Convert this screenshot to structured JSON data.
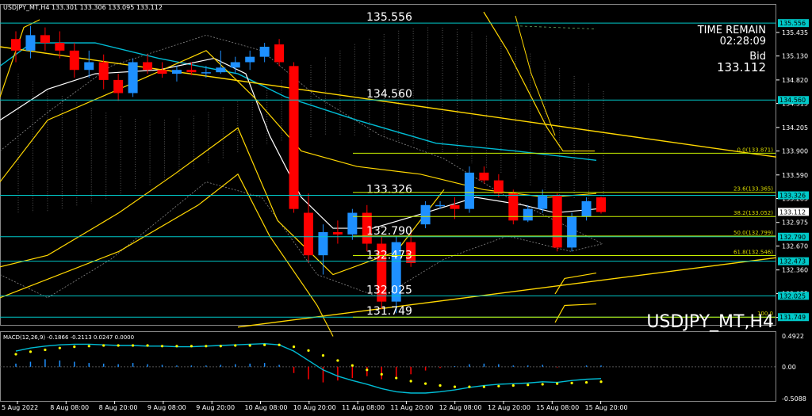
{
  "window": {
    "header": "USDJPY_MT,H4  133.301 133.306 133.095 133.112",
    "watermark": "USDJPY_MT,H4"
  },
  "time_remain": {
    "title": "TIME REMAIN",
    "value": "02:28:09",
    "bid_label": "Bid",
    "bid_value": "133.112"
  },
  "colors": {
    "background": "#000000",
    "bull": "#1e90ff",
    "bear": "#ff0000",
    "hline": "#00c8c8",
    "fib": "#c8f000",
    "trend": "#ffd700",
    "ma_white": "#ffffff",
    "ma_cyan": "#00bcd4",
    "macd_hist": "#1e90ff",
    "macd_line": "#00bcd4",
    "macd_signal": "#ffff00"
  },
  "levels": [
    {
      "label": "135.556",
      "price": 135.556
    },
    {
      "label": "134.560",
      "price": 134.56
    },
    {
      "label": "133.326",
      "price": 133.326
    },
    {
      "label": "132.790",
      "price": 132.79
    },
    {
      "label": "132.473",
      "price": 132.473
    },
    {
      "label": "132.025",
      "price": 132.025
    },
    {
      "label": "131.749",
      "price": 131.749
    }
  ],
  "fib": [
    {
      "label": "0.0(133.871)",
      "price": 133.871
    },
    {
      "label": "23.6(133.365)",
      "price": 133.365
    },
    {
      "label": "38.2(133.052)",
      "price": 133.052
    },
    {
      "label": "50.0(132.799)",
      "price": 132.799
    },
    {
      "label": "61.8(132.546)",
      "price": 132.546
    },
    {
      "label": "100.0",
      "price": 131.749
    }
  ],
  "price_axis": {
    "ticks": [
      "135.435",
      "135.130",
      "134.820",
      "134.515",
      "134.205",
      "133.900",
      "133.590",
      "133.285",
      "132.975",
      "132.670",
      "132.360",
      "132.055",
      "131.745"
    ],
    "tags": [
      {
        "label": "135.556",
        "price": 135.556,
        "color": "#00c8c8"
      },
      {
        "label": "134.560",
        "price": 134.56,
        "color": "#00c8c8"
      },
      {
        "label": "133.326",
        "price": 133.326,
        "color": "#00c8c8"
      },
      {
        "label": "133.112",
        "price": 133.112,
        "color": "#ffffff"
      },
      {
        "label": "132.790",
        "price": 132.79,
        "color": "#00c8c8"
      },
      {
        "label": "132.473",
        "price": 132.473,
        "color": "#00c8c8"
      },
      {
        "label": "132.025",
        "price": 132.025,
        "color": "#00c8c8"
      },
      {
        "label": "131.749",
        "price": 131.749,
        "color": "#00c8c8"
      }
    ]
  },
  "time_axis": [
    "5 Aug 2022",
    "8 Aug 08:00",
    "8 Aug 20:00",
    "9 Aug 08:00",
    "9 Aug 20:00",
    "10 Aug 08:00",
    "10 Aug 20:00",
    "11 Aug 08:00",
    "11 Aug 20:00",
    "12 Aug 08:00",
    "12 Aug 20:00",
    "15 Aug 08:00",
    "15 Aug 20:00"
  ],
  "macd": {
    "label": "MACD(12,26,9) -0.1866 -0.2113 0.0247 0.0000",
    "axis": [
      "0.4922",
      "0.00",
      "-0.5088"
    ],
    "range": [
      -0.5088,
      0.4922
    ]
  },
  "chart_data": {
    "type": "candlestick",
    "symbol": "USDJPY_MT",
    "timeframe": "H4",
    "ylim": [
      131.7,
      135.65
    ],
    "ohlc": [
      [
        135.35,
        135.45,
        135.05,
        135.2
      ],
      [
        135.2,
        135.52,
        135.1,
        135.4
      ],
      [
        135.4,
        135.5,
        135.2,
        135.3
      ],
      [
        135.3,
        135.45,
        135.1,
        135.2
      ],
      [
        135.2,
        135.3,
        134.85,
        134.95
      ],
      [
        134.95,
        135.2,
        134.85,
        135.05
      ],
      [
        135.05,
        135.15,
        134.7,
        134.82
      ],
      [
        134.82,
        134.9,
        134.55,
        134.65
      ],
      [
        134.65,
        135.1,
        134.6,
        135.05
      ],
      [
        135.05,
        135.15,
        134.9,
        134.95
      ],
      [
        134.95,
        135.05,
        134.85,
        134.9
      ],
      [
        134.9,
        135.0,
        134.8,
        134.95
      ],
      [
        134.95,
        135.05,
        134.88,
        134.92
      ],
      [
        134.92,
        135.0,
        134.85,
        134.92
      ],
      [
        134.92,
        135.2,
        134.9,
        134.98
      ],
      [
        134.98,
        135.12,
        134.9,
        135.05
      ],
      [
        135.05,
        135.2,
        134.95,
        135.12
      ],
      [
        135.12,
        135.3,
        135.05,
        135.25
      ],
      [
        135.28,
        135.35,
        135.0,
        135.05
      ],
      [
        135.0,
        135.05,
        133.1,
        133.15
      ],
      [
        133.1,
        133.35,
        132.45,
        132.55
      ],
      [
        132.55,
        132.95,
        132.3,
        132.85
      ],
      [
        132.85,
        133.0,
        132.7,
        132.82
      ],
      [
        132.82,
        133.15,
        132.75,
        133.1
      ],
      [
        133.1,
        133.2,
        132.6,
        132.7
      ],
      [
        132.7,
        132.8,
        131.85,
        131.95
      ],
      [
        131.95,
        132.8,
        131.8,
        132.72
      ],
      [
        132.72,
        132.9,
        132.4,
        132.45
      ],
      [
        132.95,
        133.25,
        132.9,
        133.2
      ],
      [
        133.2,
        133.25,
        133.15,
        133.2
      ],
      [
        133.2,
        133.3,
        133.02,
        133.15
      ],
      [
        133.15,
        133.7,
        133.1,
        133.62
      ],
      [
        133.62,
        133.7,
        133.48,
        133.52
      ],
      [
        133.52,
        133.6,
        133.3,
        133.35
      ],
      [
        133.35,
        133.4,
        132.95,
        133.0
      ],
      [
        133.0,
        133.2,
        132.98,
        133.15
      ],
      [
        133.15,
        133.4,
        133.1,
        133.32
      ],
      [
        133.32,
        133.35,
        132.6,
        132.65
      ],
      [
        132.65,
        133.1,
        132.6,
        133.05
      ],
      [
        133.05,
        133.3,
        133.0,
        133.25
      ],
      [
        133.3,
        133.31,
        133.09,
        133.11
      ]
    ],
    "trendlines": "descending resistance and ascending support",
    "grid": false
  }
}
